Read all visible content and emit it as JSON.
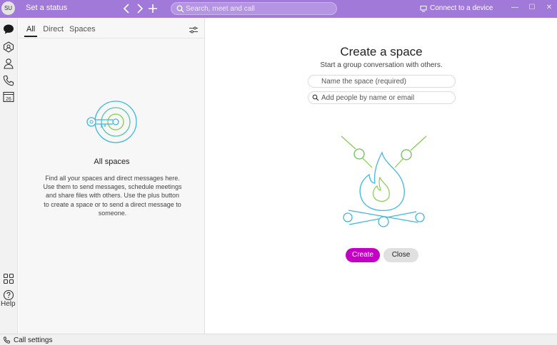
{
  "titlebar": {
    "avatar_initials": "SU",
    "status_label": "Set a status",
    "search_placeholder": "Search, meet and call",
    "connect_label": "Connect to a device",
    "bg_color": "#a17ad9"
  },
  "rail": {
    "icons": [
      "messaging-icon",
      "teams-icon",
      "contacts-icon",
      "calls-icon",
      "calendar-icon",
      "apps-icon",
      "help-icon"
    ],
    "calendar_day": "26",
    "help_label": "Help"
  },
  "panel": {
    "tabs": [
      {
        "label": "All",
        "active": true
      },
      {
        "label": "Direct",
        "active": false
      },
      {
        "label": "Spaces",
        "active": false
      }
    ],
    "empty_title": "All spaces",
    "empty_description": "Find all your spaces and direct messages here. Use them to send messages, schedule meetings and share files with others. Use the plus button to create a space or to send a direct message to someone."
  },
  "main": {
    "title": "Create a space",
    "subtitle": "Start a group conversation with others.",
    "name_placeholder": "Name the space (required)",
    "people_placeholder": "Add people by name or email",
    "create_label": "Create",
    "close_label": "Close",
    "accent_color": "#c400c4"
  },
  "bottombar": {
    "call_settings_label": "Call settings"
  }
}
